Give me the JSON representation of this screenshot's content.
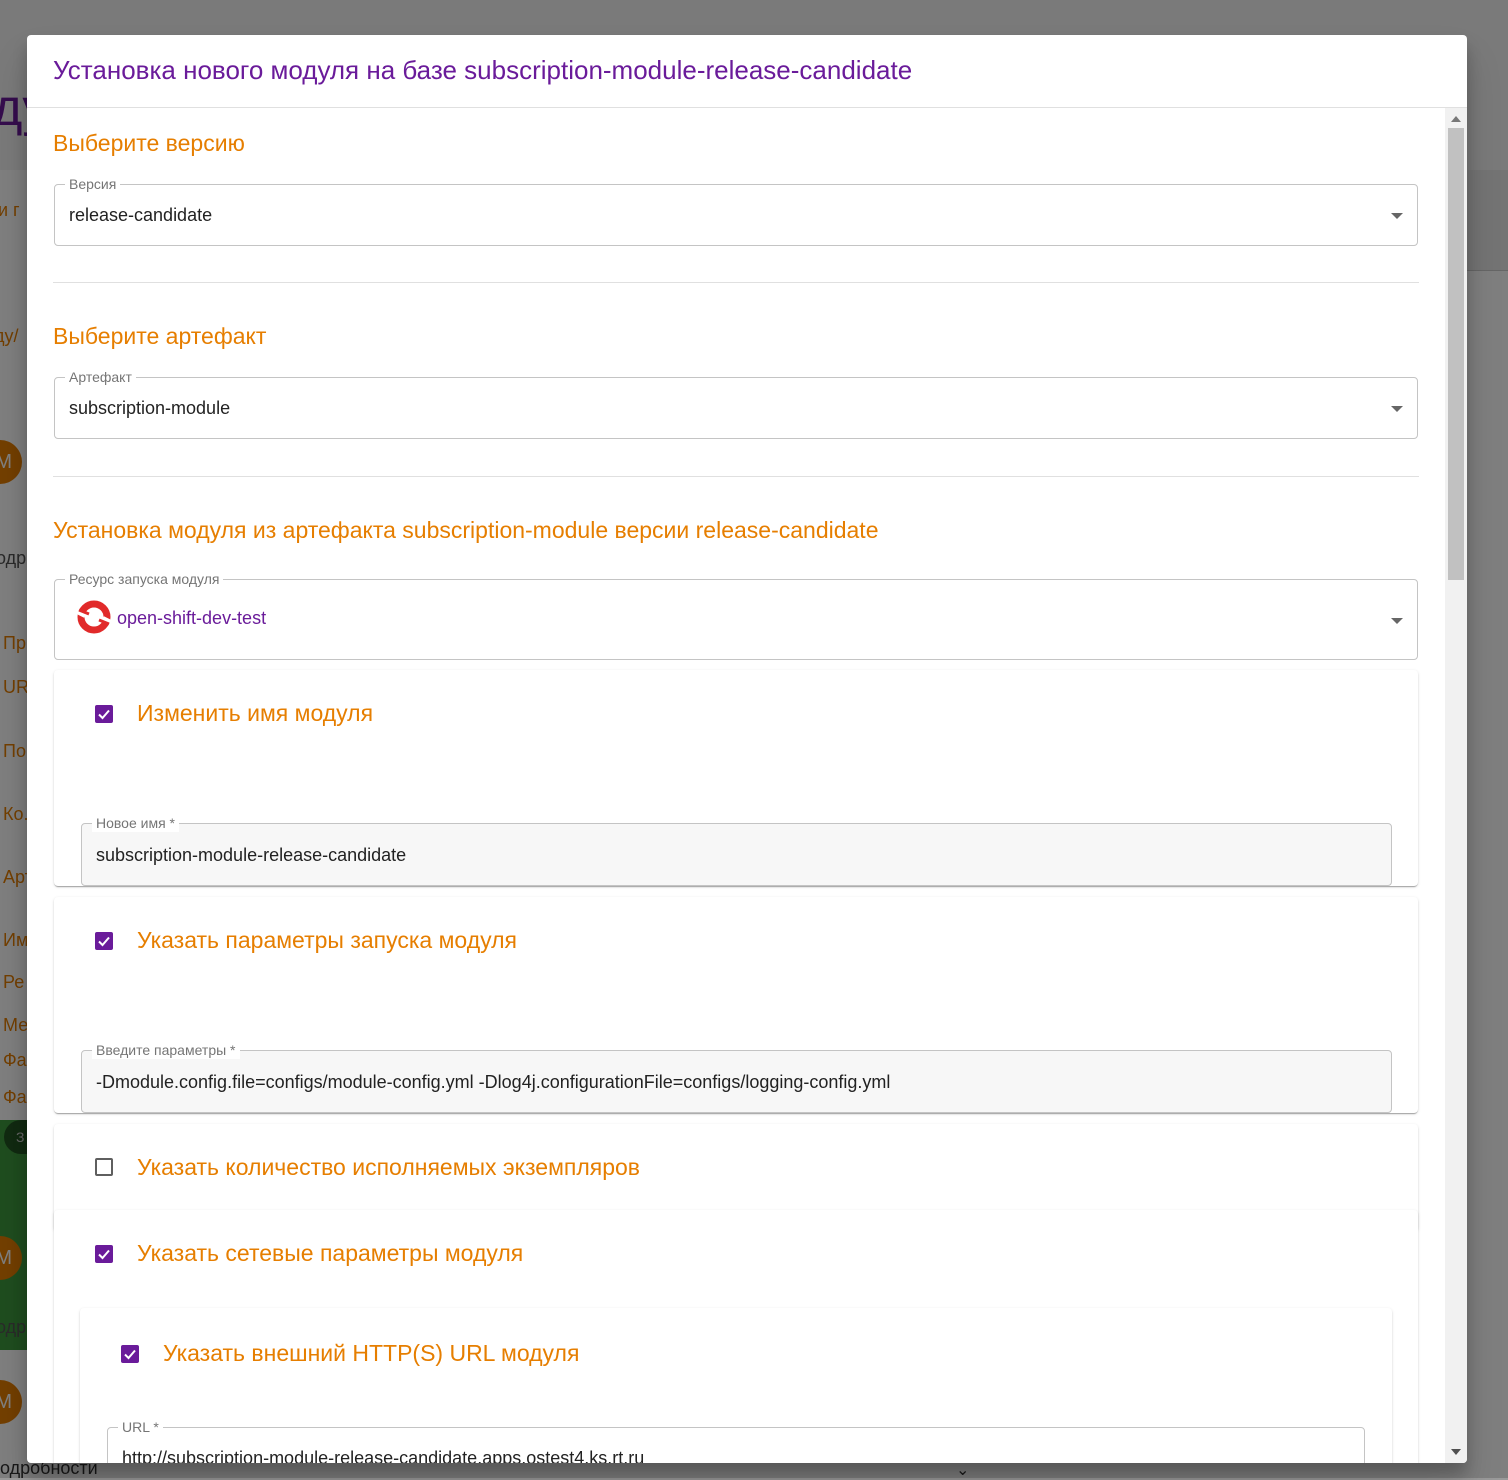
{
  "background": {
    "header_fragment": "ду",
    "items": [
      "и г",
      "ду/",
      "одр",
      "Пр",
      "UR",
      "По",
      "Ко.",
      "Арт",
      "Им",
      "Ре",
      "Ме",
      "Фа",
      "Фа"
    ],
    "avatar_letter": "М",
    "chip": "З",
    "bottom_text": "одробности"
  },
  "dialog": {
    "title": "Установка нового модуля на базе subscription-module-release-candidate",
    "version_section": {
      "title": "Выберите версию",
      "field_label": "Версия",
      "value": "release-candidate"
    },
    "artifact_section": {
      "title": "Выберите артефакт",
      "field_label": "Артефакт",
      "value": "subscription-module"
    },
    "install_section": {
      "title": "Установка модуля из артефакта subscription-module версии release-candidate",
      "resource_label": "Ресурс запуска модуля",
      "resource_value": "open-shift-dev-test"
    },
    "rename": {
      "checked": true,
      "label": "Изменить имя модуля",
      "field_label": "Новое имя *",
      "value": "subscription-module-release-candidate"
    },
    "params": {
      "checked": true,
      "label": "Указать параметры запуска модуля",
      "field_label": "Введите параметры *",
      "value": "-Dmodule.config.file=configs/module-config.yml -Dlog4j.configurationFile=configs/logging-config.yml"
    },
    "instances": {
      "checked": false,
      "label": "Указать количество исполняемых экземпляров"
    },
    "network": {
      "checked": true,
      "label": "Указать сетевые параметры модуля",
      "external_url": {
        "checked": true,
        "label": "Указать внешний HTTP(S) URL модуля",
        "field_label": "URL *",
        "value": "http://subscription-module-release-candidate.apps.ostest4.ks.rt.ru"
      }
    }
  },
  "colors": {
    "accent_purple": "#6a1b9a",
    "accent_orange": "#e67e00"
  }
}
